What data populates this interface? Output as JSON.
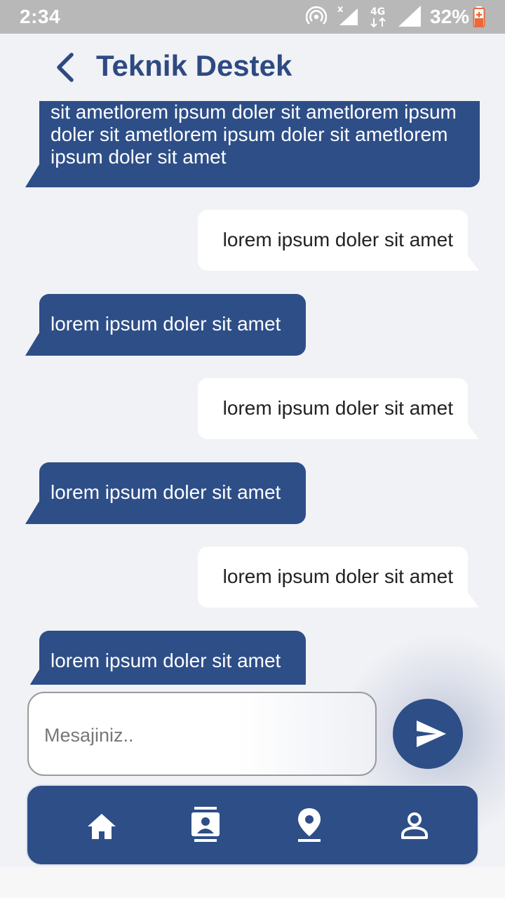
{
  "status_bar": {
    "time": "2:34",
    "battery": "32%",
    "network": "4G"
  },
  "header": {
    "title": "Teknik Destek",
    "back_icon": "chevron-left-icon"
  },
  "messages": [
    {
      "side": "incoming",
      "text": "sit ametlorem ipsum doler sit ametlorem ipsum doler sit ametlorem ipsum doler sit ametlorem ipsum doler sit amet"
    },
    {
      "side": "outgoing",
      "text": "lorem ipsum doler sit amet"
    },
    {
      "side": "incoming",
      "text": "lorem ipsum doler sit amet"
    },
    {
      "side": "outgoing",
      "text": "lorem ipsum doler sit amet"
    },
    {
      "side": "incoming",
      "text": "lorem ipsum doler sit amet"
    },
    {
      "side": "outgoing",
      "text": "lorem ipsum doler sit amet"
    },
    {
      "side": "incoming",
      "text": "lorem ipsum doler sit amet"
    }
  ],
  "composer": {
    "placeholder": "Mesajiniz..",
    "value": "",
    "send_icon": "send-icon"
  },
  "bottom_nav": {
    "items": [
      {
        "icon": "home-icon"
      },
      {
        "icon": "contacts-icon"
      },
      {
        "icon": "location-pin-icon"
      },
      {
        "icon": "profile-icon"
      }
    ]
  },
  "colors": {
    "primary": "#2e4e87",
    "title": "#2e4a82",
    "background": "#f1f2f6",
    "incoming_bubble": "#2e4e87",
    "outgoing_bubble": "#ffffff",
    "status_bar": "#b8b8b8"
  }
}
